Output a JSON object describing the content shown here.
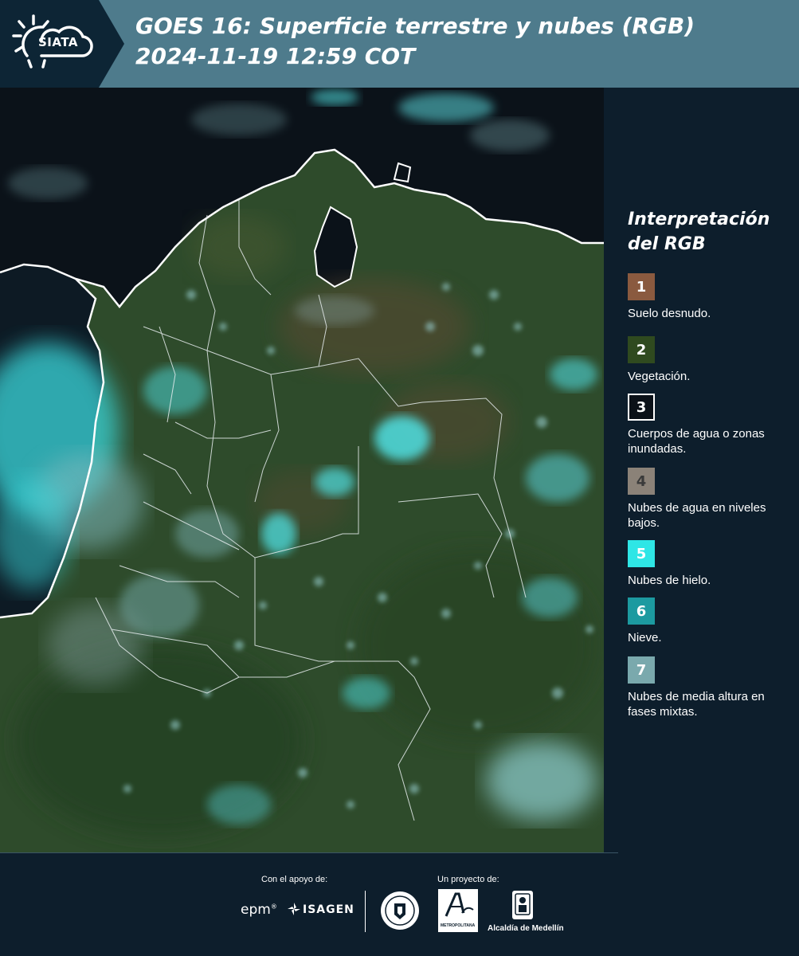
{
  "header": {
    "brand": "SIATA",
    "title_line1": "GOES 16: Superficie terrestre y nubes (RGB)",
    "title_line2": " 2024-11-19 12:59 COT"
  },
  "legend": {
    "title_line1": "Interpretación",
    "title_line2": "del RGB",
    "items": [
      {
        "num": "1",
        "label": "Suelo desnudo.",
        "color": "#8a5a3f",
        "text_color": "#ffffff",
        "border": "#8a5a3f"
      },
      {
        "num": "2",
        "label": "Vegetación.",
        "color": "#2f4a1f",
        "text_color": "#ffffff",
        "border": "#2f4a1f"
      },
      {
        "num": "3",
        "label": "Cuerpos de agua o zonas inundadas.",
        "color": "#0b1118",
        "text_color": "#ffffff",
        "border": "#ffffff"
      },
      {
        "num": "4",
        "label": "Nubes de agua en niveles bajos.",
        "color": "#8b8278",
        "text_color": "#3a3a3a",
        "border": "#8b8278"
      },
      {
        "num": "5",
        "label": "Nubes de hielo.",
        "color": "#2ee6e6",
        "text_color": "#ffffff",
        "border": "#2ee6e6"
      },
      {
        "num": "6",
        "label": "Nieve.",
        "color": "#1c9aa0",
        "text_color": "#ffffff",
        "border": "#1c9aa0"
      },
      {
        "num": "7",
        "label": "Nubes de media altura en fases mixtas.",
        "color": "#7aa9ad",
        "text_color": "#ffffff",
        "border": "#7aa9ad"
      }
    ]
  },
  "footer": {
    "support_label": "Con el apoyo de:",
    "project_label": "Un proyecto de:",
    "partner1": "epm",
    "partner2": "ISAGEN",
    "partner3": "Alcaldía de Medellín",
    "partner4": "METROPOLITANA"
  },
  "colors": {
    "header_bg": "#4e7b8c",
    "page_bg": "#0d1e2c",
    "vegetation": "#2f4a1f",
    "ocean": "#0b1118",
    "ice_cloud": "#2ee6e6"
  }
}
